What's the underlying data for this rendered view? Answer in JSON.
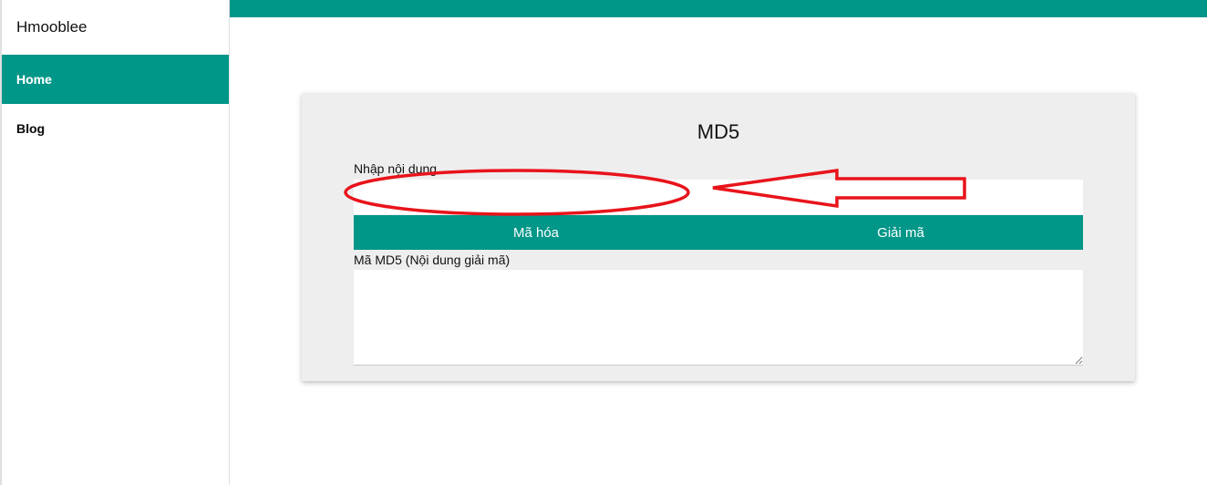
{
  "sidebar": {
    "brand": "Hmooblee",
    "items": [
      {
        "label": "Home",
        "active": true
      },
      {
        "label": "Blog",
        "active": false
      }
    ]
  },
  "colors": {
    "accent": "#009688",
    "card_bg": "#eeeeee",
    "annotation": "#e8141b"
  },
  "tool": {
    "title": "MD5",
    "input_label": "Nhập nội dung",
    "input_value": "",
    "encode_label": "Mã hóa",
    "decode_label": "Giải mã",
    "output_label": "Mã MD5 (Nội dung giải mã)",
    "output_value": ""
  },
  "annotation": {
    "shapes": [
      "ellipse-highlight",
      "arrow-left"
    ]
  }
}
